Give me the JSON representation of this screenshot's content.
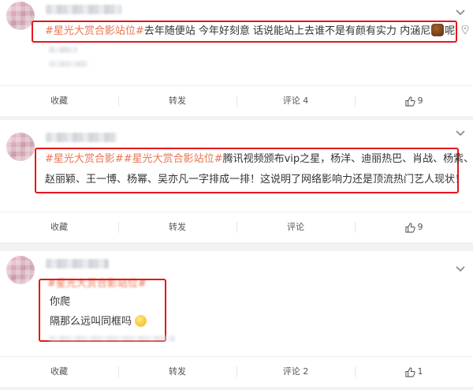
{
  "posts": [
    {
      "tag": "#星光大赏合影站位#",
      "text": "去年随便站 今年好刻意 话说能站上去谁不是有颜有实力 内涵尼",
      "tail": "呢",
      "actions": {
        "collect": "收藏",
        "repost": "转发",
        "comment": "评论 4",
        "like": "9"
      }
    },
    {
      "tags": "#星光大赏合影##星光大赏合影站位#",
      "line1": "腾讯视频颁布vip之星，杨洋、迪丽热巴、肖战、杨紫、",
      "line2": "赵丽颖、王一博、杨幂、吴亦凡一字排成一排！这说明了网络影响力还是顶流热门艺人现状！",
      "actions": {
        "collect": "收藏",
        "repost": "转发",
        "comment": "评论",
        "like": "9"
      }
    },
    {
      "tag": "#星光大赏合影站位#",
      "line1": "你爬",
      "line2": "隔那么远叫同框吗",
      "actions": {
        "collect": "收藏",
        "repost": "转发",
        "comment": "评论 2",
        "like": "1"
      }
    }
  ],
  "colors": {
    "highlight": "#e8151b",
    "topic": "#eb7350",
    "background": "#f2f2f2"
  },
  "icons": [
    "chevron-down-icon",
    "location-icon",
    "thumbs-up-icon",
    "emoji-icon"
  ]
}
